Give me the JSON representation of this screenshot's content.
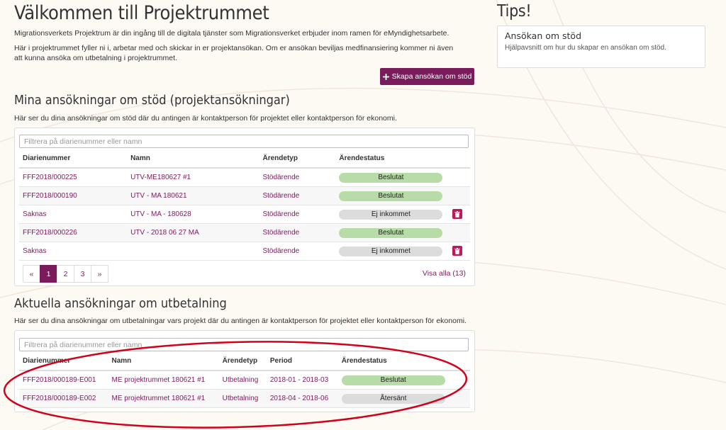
{
  "page": {
    "title": "Välkommen till Projektrummet",
    "intro1": "Migrationsverkets Projektrum är din ingång till de digitala tjänster som Migrationsverket erbjuder inom ramen för eMyndighetsarbete.",
    "intro2": "Här i projektrummet fyller ni i, arbetar med och skickar in er projektansökan. Om er ansökan beviljas medfinansiering kommer ni även att kunna ansöka om utbetalning i projektrummet.",
    "create_button": "Skapa ansökan om stöd"
  },
  "support": {
    "heading": "Mina ansökningar om stöd (projektansökningar)",
    "description": "Här ser du dina ansökningar om stöd där du antingen är kontaktperson för projektet eller kontaktperson för ekonomi.",
    "filter_placeholder": "Filtrera på diarienummer eller namn",
    "columns": [
      "Diarienummer",
      "Namn",
      "Ärendetyp",
      "Ärendestatus"
    ],
    "rows": [
      {
        "id": "FFF2018/000225",
        "name": "UTV-ME180627 #1",
        "type": "Stödärende",
        "status": "Beslutat",
        "deletable": false
      },
      {
        "id": "FFF2018/000190",
        "name": "UTV - MA 180621",
        "type": "Stödärende",
        "status": "Beslutat",
        "deletable": false
      },
      {
        "id": "Saknas",
        "name": "UTV - MA - 180628",
        "type": "Stödärende",
        "status": "Ej inkommet",
        "deletable": true
      },
      {
        "id": "FFF2018/000226",
        "name": "UTV - 2018 06 27 MA",
        "type": "Stödärende",
        "status": "Beslutat",
        "deletable": false
      },
      {
        "id": "Saknas",
        "name": "",
        "type": "Stödärende",
        "status": "Ej inkommet",
        "deletable": true
      }
    ],
    "pagination": {
      "prev": "«",
      "pages": [
        "1",
        "2",
        "3"
      ],
      "current": "1",
      "next": "»"
    },
    "view_all": "Visa alla (13)"
  },
  "payout": {
    "heading": "Aktuella ansökningar om utbetalning",
    "description": "Här ser du dina ansökningar om utbetalningar vars projekt där du antingen är kontaktperson för projektet eller kontaktperson för ekonomi.",
    "filter_placeholder": "Filtrera på diarienummer eller namn",
    "columns": [
      "Diarienummer",
      "Namn",
      "Ärendetyp",
      "Period",
      "Ärendestatus"
    ],
    "rows": [
      {
        "id": "FFF2018/000189-E001",
        "name": "ME projektrummet 180621 #1",
        "type": "Utbetalning",
        "period": "2018-01 - 2018-03",
        "status": "Beslutat"
      },
      {
        "id": "FFF2018/000189-E002",
        "name": "ME projektrummet 180621 #1",
        "type": "Utbetalning",
        "period": "2018-04 - 2018-06",
        "status": "Återsänt"
      }
    ]
  },
  "tips": {
    "heading": "Tips!",
    "item_title": "Ansökan om stöd",
    "item_text": "Hjälpavsnitt om hur du skapar en ansökan om stöd."
  },
  "colors": {
    "brand": "#7a1b5c",
    "status_decided": "#b7dca8",
    "status_neutral": "#dcdcdc",
    "delete": "#c2185b",
    "annotation": "#d0021b"
  },
  "icons": {
    "create": "plus-icon",
    "delete": "trash-icon"
  }
}
